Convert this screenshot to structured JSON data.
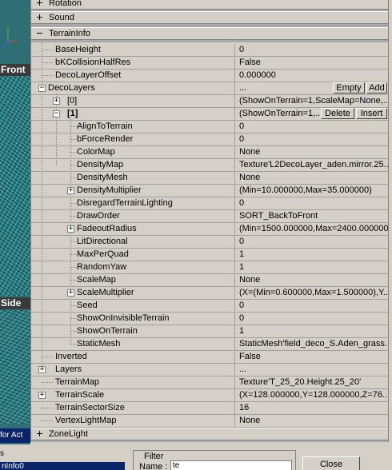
{
  "background": {
    "viewport_front_label": "Front",
    "viewport_side_label": "Side",
    "side_status_text": "for Act",
    "list_header": "s",
    "list_selected_item": "nInfo0",
    "filter_title": "Filter",
    "name_label": "Name :",
    "name_value": "te",
    "close_label": "Close"
  },
  "categories": {
    "rotation": "Rotation",
    "sound": "Sound",
    "terrain_info": "TerrainInfo",
    "zone_light": "ZoneLight"
  },
  "buttons": {
    "empty": "Empty",
    "add": "Add",
    "delete": "Delete",
    "insert": "Insert"
  },
  "rows": [
    {
      "name": "BaseHeight",
      "value": "0"
    },
    {
      "name": "bKCollisionHalfRes",
      "value": "False"
    },
    {
      "name": "DecoLayerOffset",
      "value": "0.000000"
    },
    {
      "name": "DecoLayers",
      "value": "..."
    },
    {
      "name": "[0]",
      "value": "(ShowOnTerrain=1,ScaleMap=None,..."
    },
    {
      "name": "[1]",
      "value": "(ShowOnTerrain=1,..."
    },
    {
      "name": "AlignToTerrain",
      "value": "0"
    },
    {
      "name": "bForceRender",
      "value": "0"
    },
    {
      "name": "ColorMap",
      "value": "None"
    },
    {
      "name": "DensityMap",
      "value": "Texture'L2DecoLayer_aden.mirror.25..."
    },
    {
      "name": "DensityMesh",
      "value": "None"
    },
    {
      "name": "DensityMultiplier",
      "value": "(Min=10.000000,Max=35.000000)"
    },
    {
      "name": "DisregardTerrainLighting",
      "value": "0"
    },
    {
      "name": "DrawOrder",
      "value": "SORT_BackToFront"
    },
    {
      "name": "FadeoutRadius",
      "value": "(Min=1500.000000,Max=2400.000000)"
    },
    {
      "name": "LitDirectional",
      "value": "0"
    },
    {
      "name": "MaxPerQuad",
      "value": "1"
    },
    {
      "name": "RandomYaw",
      "value": "1"
    },
    {
      "name": "ScaleMap",
      "value": "None"
    },
    {
      "name": "ScaleMultiplier",
      "value": "(X=(Min=0.600000,Max=1.500000),Y..."
    },
    {
      "name": "Seed",
      "value": "0"
    },
    {
      "name": "ShowOnInvisibleTerrain",
      "value": "0"
    },
    {
      "name": "ShowOnTerrain",
      "value": "1"
    },
    {
      "name": "StaticMesh",
      "value": "StaticMesh'field_deco_S.Aden_grass..."
    },
    {
      "name": "Inverted",
      "value": "False"
    },
    {
      "name": "Layers",
      "value": "..."
    },
    {
      "name": "TerrainMap",
      "value": "Texture'T_25_20.Height.25_20'"
    },
    {
      "name": "TerrainScale",
      "value": "(X=128.000000,Y=128.000000,Z=76..."
    },
    {
      "name": "TerrainSectorSize",
      "value": "16"
    },
    {
      "name": "VertexLightMap",
      "value": "None"
    }
  ]
}
